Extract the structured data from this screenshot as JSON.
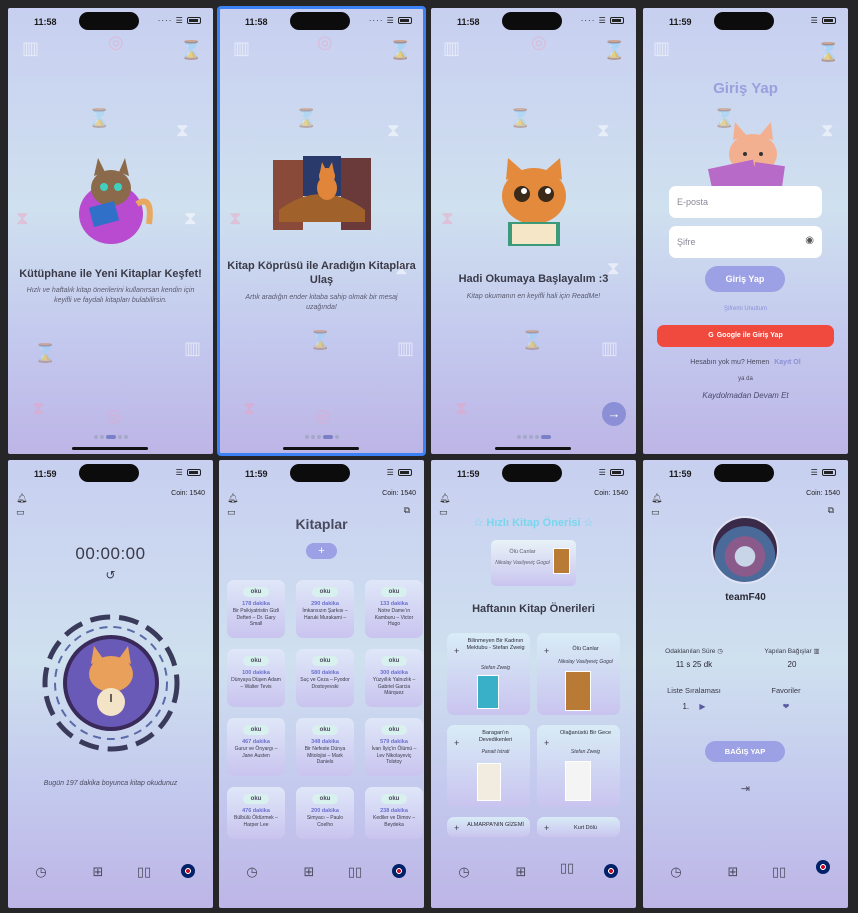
{
  "status": {
    "time_1": "11:58",
    "time_2": "11:59"
  },
  "onboarding": [
    {
      "title": "Kütüphane ile Yeni Kitaplar Keşfet!",
      "subtitle": "Hızlı ve haftalık kitap önerilerini kullanırsan kendin için keyifli ve faydalı kitapları bulabilirsin."
    },
    {
      "title": "Kitap Köprüsü ile Aradığın Kitaplara Ulaş",
      "subtitle": "Artık aradığın ender kitaba sahip olmak bir mesaj uzağında!"
    },
    {
      "title": "Hadi Okumaya Başlayalım :3",
      "subtitle": "Kitap okumanın en keyifli hali için ReadMe!"
    }
  ],
  "login": {
    "title": "Giriş Yap",
    "email_placeholder": "E-posta",
    "password_placeholder": "Şifre",
    "login_button": "Giriş Yap",
    "forgot_password": "Şifremi Unuttum",
    "google_button": "Google ile Giriş Yap",
    "no_account": "Hesabın yok mu? Hemen",
    "register": "Kayıt Ol",
    "or": "ya da",
    "continue_guest": "Kaydolmadan Devam Et"
  },
  "app": {
    "coin": "Coin: 1540"
  },
  "timer": {
    "time": "00:00:00",
    "caption": "Bugün 197 dakika boyunca kitap okudunuz"
  },
  "books": {
    "title": "Kitaplar",
    "add": "+",
    "read_label": "oku",
    "items": [
      {
        "minutes": "178 dakika",
        "title": "Bir Psikiyatristin Gizli Defteri – Dr. Gary Small"
      },
      {
        "minutes": "290 dakika",
        "title": "İmkansızın Şarkısı – Haruki Murakami –"
      },
      {
        "minutes": "133 dakika",
        "title": "Notre Dame’ın Kamburu – Victor Hugo"
      },
      {
        "minutes": "100 dakika",
        "title": "Dünyaya Düşen Adam – Walter Tevis"
      },
      {
        "minutes": "580 dakika",
        "title": "Suç ve Ceza – Fyodor Dostoyevski"
      },
      {
        "minutes": "300 dakika",
        "title": "Yüzyıllık Yalnızlık – Gabriel Garcia Márquez"
      },
      {
        "minutes": "467 dakika",
        "title": "Gurur ve Önyargı – Jane Austen"
      },
      {
        "minutes": "348 dakika",
        "title": "Bir Nefeste Dünya Mitolojisi – Mark Daniels"
      },
      {
        "minutes": "579 dakika",
        "title": "İvan İlyiç’in Ölümü – Lev Nikolayeviç Tolstoy"
      },
      {
        "minutes": "476 dakika",
        "title": "Bülbülü Öldürmek – Harper Lee"
      },
      {
        "minutes": "200 dakika",
        "title": "Simyacı – Paulo Coelho"
      },
      {
        "minutes": "238 dakika",
        "title": "Kediler ve Dimov – Beydeka"
      }
    ]
  },
  "suggest": {
    "quick_title": "Hızlı Kitap Önerisi",
    "quick_book": {
      "title": "Ölü Canlar",
      "author": "Nikolay Vasilyeviç Gogol"
    },
    "weekly_title": "Haftanın Kitap Önerileri",
    "items": [
      {
        "title": "Bilinmeyen Bir Kadının Mektubu - Stefan Zweig",
        "author": "Stefan Zweig"
      },
      {
        "title": "Ölü Canlar",
        "author": "Nikolay Vasilyeviç Gogol"
      },
      {
        "title": "Baragan'ın Devedikenleri",
        "author": "Panait Istrati"
      },
      {
        "title": "Olağanüstü Bir Gece",
        "author": "Stefan Zweig"
      },
      {
        "title": "ALMARPA'NIN GİZEMİ",
        "author": ""
      },
      {
        "title": "Kurt Dölü",
        "author": ""
      }
    ]
  },
  "profile": {
    "username": "teamF40",
    "focus_label": "Odaklanılan Süre",
    "focus_value": "11 s 25 dk",
    "donation_label": "Yapılan Bağışlar",
    "donation_value": "20",
    "rank_label": "Liste Sıralaması",
    "rank_value": "1.",
    "favorites_label": "Favoriler",
    "donate_button": "BAĞIŞ YAP"
  }
}
